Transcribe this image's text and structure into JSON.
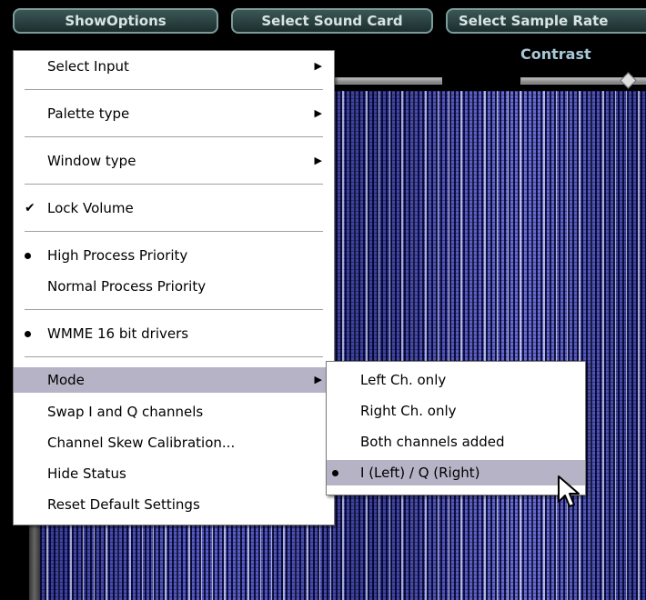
{
  "toolbar": {
    "buttons": [
      "ShowOptions",
      "Select Sound Card",
      "Select Sample Rate"
    ]
  },
  "contrast_label": "Contrast",
  "main_menu": {
    "items": [
      {
        "label": "Select Input",
        "submenu": true
      },
      {
        "label": "Palette type",
        "submenu": true
      },
      {
        "label": "Window type",
        "submenu": true
      },
      {
        "label": "Lock Volume",
        "mark": "check"
      },
      {
        "label": "High Process Priority",
        "mark": "bullet"
      },
      {
        "label": "Normal Process Priority"
      },
      {
        "label": "WMME 16 bit drivers",
        "mark": "bullet"
      },
      {
        "label": "Mode",
        "submenu": true,
        "highlighted": true
      },
      {
        "label": "Swap I and Q channels"
      },
      {
        "label": "Channel Skew Calibration..."
      },
      {
        "label": "Hide Status"
      },
      {
        "label": "Reset Default Settings"
      }
    ]
  },
  "mode_submenu": {
    "items": [
      {
        "label": "Left Ch. only"
      },
      {
        "label": "Right Ch. only"
      },
      {
        "label": "Both channels added"
      },
      {
        "label": "I (Left) / Q (Right)",
        "mark": "bullet",
        "highlighted": true
      }
    ]
  },
  "colors": {
    "menu_highlight": "#b6b3c6",
    "waterfall_base": "#3a3f9a",
    "button_border": "#7c9c9c"
  }
}
